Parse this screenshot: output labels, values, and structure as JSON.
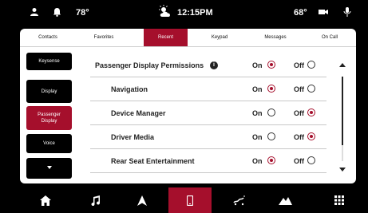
{
  "status": {
    "outside_temp": "78°",
    "time": "12:15PM",
    "inside_temp": "68°"
  },
  "tabs": [
    "Contacts",
    "Favorites",
    "Recent",
    "Keypad",
    "Messages",
    "On Call"
  ],
  "active_tab": "Recent",
  "sidebar": {
    "items": [
      "Keysense",
      "Display",
      "Passenger Display",
      "Voice"
    ],
    "active": "Passenger Display"
  },
  "settings": {
    "on_label": "On",
    "off_label": "Off",
    "rows": [
      {
        "label": "Passenger Display Permissions",
        "value": "On"
      },
      {
        "label": "Navigation",
        "value": "On"
      },
      {
        "label": "Device Manager",
        "value": "Off"
      },
      {
        "label": "Driver Media",
        "value": "Off"
      },
      {
        "label": "Rear Seat Entertainment",
        "value": "On"
      }
    ]
  },
  "bottom_nav": {
    "items": [
      "home-icon",
      "music-note-icon",
      "navigation-arrow-icon",
      "phone-icon",
      "car-controls-icon",
      "mountains-icon",
      "app-grid-icon"
    ],
    "active": "phone-icon"
  },
  "colors": {
    "accent": "#a50f2c",
    "panel": "#ffffff",
    "background": "#000000"
  }
}
